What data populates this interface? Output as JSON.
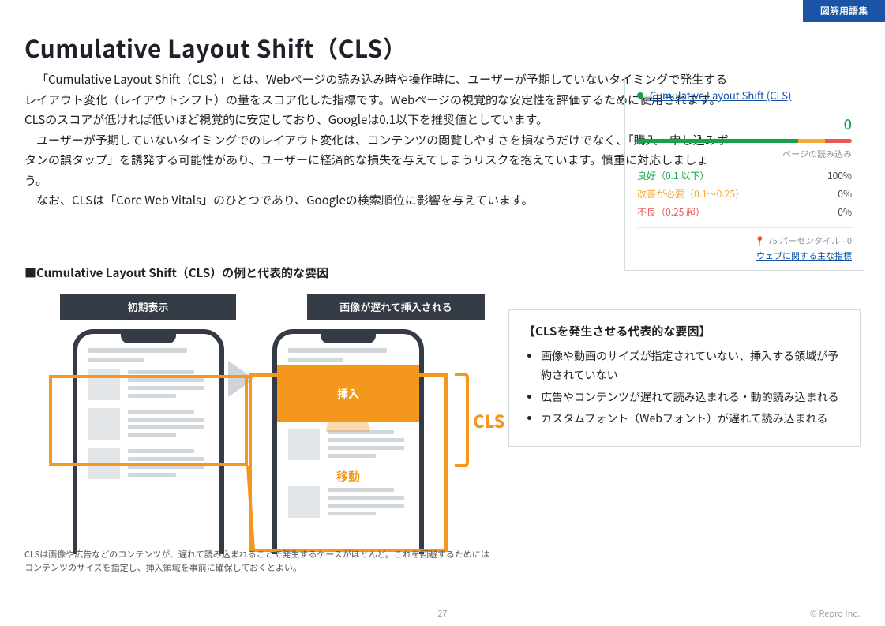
{
  "badge": "図解用語集",
  "title": "Cumulative Layout Shift（CLS）",
  "intro": {
    "p1": "「Cumulative Layout Shift（CLS）」とは、Webページの読み込み時や操作時に、ユーザーが予期していないタイミングで発生するレイアウト変化（レイアウトシフト）の量をスコア化した指標です。Webページの視覚的な安定性を評価するために使用されます。CLSのスコアが低ければ低いほど視覚的に安定しており、Googleは0.1以下を推奨値としています。",
    "p2": "ユーザーが予期していないタイミングでのレイアウト変化は、コンテンツの閲覧しやすさを損なうだけでなく、「購入・申し込みボタンの誤タップ」を誘発する可能性があり、ユーザーに経済的な損失を与えてしまうリスクを抱えています。慎重に対応しましょう。",
    "p3": "なお、CLSは「Core Web Vitals」のひとつであり、Googleの検索順位に影響を与えています。"
  },
  "metric": {
    "title": "Cumulative Layout Shift (CLS)",
    "score": "0",
    "xaxis": "ページの読み込み",
    "rows": [
      {
        "label": "良好（0.1 以下）",
        "value": "100%",
        "cls": "green"
      },
      {
        "label": "改善が必要（0.1～0.25）",
        "value": "0%",
        "cls": "orange"
      },
      {
        "label": "不良（0.25 超）",
        "value": "0%",
        "cls": "red"
      }
    ],
    "percentile": "75 パーセンタイル - 0",
    "link": "ウェブに関する主な指標"
  },
  "section2": "■Cumulative Layout Shift（CLS）の例と代表的な要因",
  "diagram": {
    "label1": "初期表示",
    "label2": "画像が遅れて挿入される",
    "insert": "挿入",
    "move": "移動",
    "cls": "CLS"
  },
  "caption": "CLSは画像や広告などのコンテンツが、遅れて読み込まれることで発生するケースがほとんど。これを回避するためにはコンテンツのサイズを指定し、挿入領域を事前に確保しておくとよい。",
  "causes": {
    "heading": "【CLSを発生させる代表的な要因】",
    "items": [
      "画像や動画のサイズが指定されていない、挿入する領域が予約されていない",
      "広告やコンテンツが遅れて読み込まれる・動的読み込まれる",
      "カスタムフォント（Webフォント）が遅れて読み込まれる"
    ]
  },
  "page": "27",
  "copyright": "© Repro Inc."
}
